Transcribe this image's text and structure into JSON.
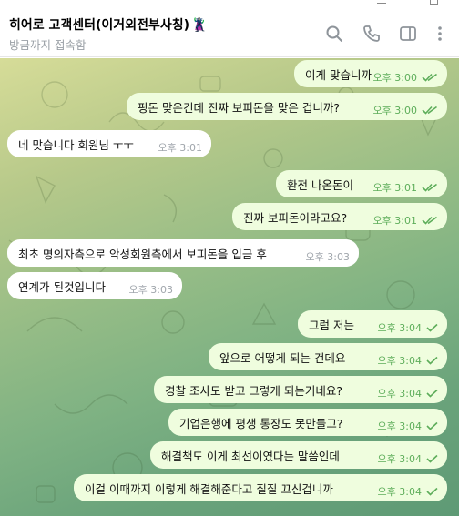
{
  "chat": {
    "title": "히어로 고객센터(이거외전부사칭)",
    "status": "방금까지 접속함"
  },
  "icons": {
    "avatar_emoji": "🦹",
    "search": "search-icon",
    "call": "phone-icon",
    "sidebar": "sidebar-toggle-icon",
    "menu": "more-vertical-icon"
  },
  "colors": {
    "outgoing_bubble": "#effdde",
    "incoming_bubble": "#ffffff",
    "outgoing_time": "#5dad5a",
    "incoming_time": "#a0a6ac"
  },
  "messages": [
    {
      "dir": "out",
      "text": "이게 맞습니까",
      "time": "오후 3:00",
      "status": "read"
    },
    {
      "dir": "out",
      "text": "핑돈 맞은건데 진짜 보피돈을 맞은 겁니까?",
      "time": "오후 3:00",
      "status": "read"
    },
    {
      "dir": "in",
      "text": "네 맞습니다 회원님 ㅜㅜ",
      "time": "오후 3:01"
    },
    {
      "dir": "out",
      "text": "환전 나온돈이",
      "time": "오후 3:01",
      "status": "read"
    },
    {
      "dir": "out",
      "text": "진짜 보피돈이라고요?",
      "time": "오후 3:01",
      "status": "read"
    },
    {
      "dir": "in",
      "text": "최초 명의자측으로 악성회원측에서 보피돈을 입금 후",
      "time": "오후 3:03"
    },
    {
      "dir": "in",
      "text": "연계가 된것입니다",
      "time": "오후 3:03"
    },
    {
      "dir": "out",
      "text": "그럼 저는",
      "time": "오후 3:04",
      "status": "sent"
    },
    {
      "dir": "out",
      "text": "앞으로 어떻게 되는 건데요",
      "time": "오후 3:04",
      "status": "sent"
    },
    {
      "dir": "out",
      "text": "경찰 조사도 받고 그렇게 되는거네요?",
      "time": "오후 3:04",
      "status": "sent"
    },
    {
      "dir": "out",
      "text": "기업은행에 평생 통장도 못만들고?",
      "time": "오후 3:04",
      "status": "sent"
    },
    {
      "dir": "out",
      "text": "해결책도 이게 최선이였다는 말씀인데",
      "time": "오후 3:04",
      "status": "sent"
    },
    {
      "dir": "out",
      "text": "이걸 이때까지 이렇게 해결해준다고 질질 끄신겁니까",
      "time": "오후 3:04",
      "status": "sent"
    }
  ]
}
